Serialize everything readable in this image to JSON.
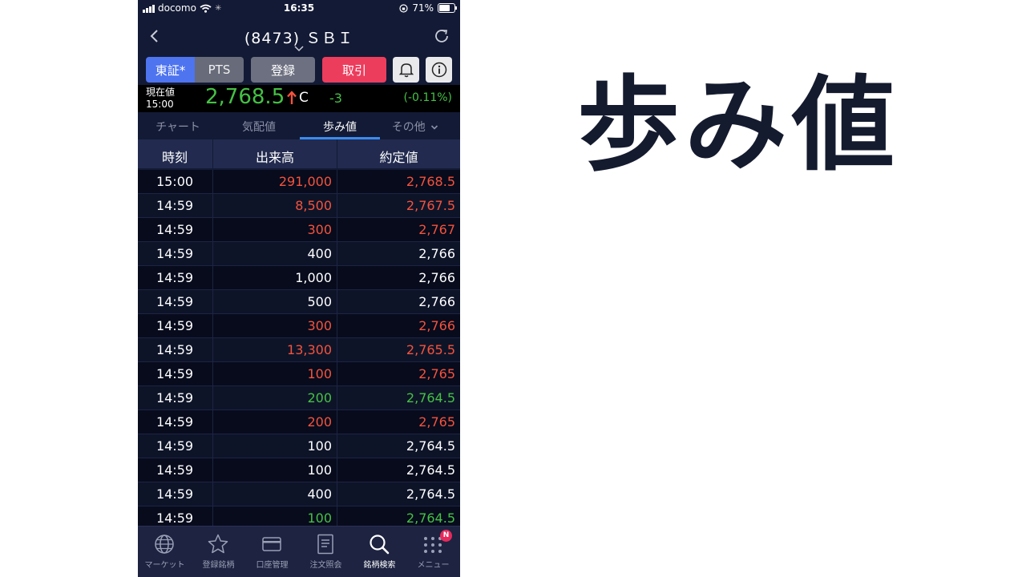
{
  "status_bar": {
    "carrier": "docomo",
    "time": "16:35",
    "battery": "71%",
    "battery_level": 0.71
  },
  "header": {
    "title": "(8473) ＳＢＩ"
  },
  "buttons": {
    "tosho": "東証*",
    "pts": "PTS",
    "register": "登録",
    "trade": "取引"
  },
  "price": {
    "label_line1": "現在値",
    "label_line2": "15:00",
    "value": "2,768.5",
    "flag": "C",
    "change": "-3",
    "change_pct": "(-0.11%)"
  },
  "tabs": [
    {
      "label": "チャート"
    },
    {
      "label": "気配値"
    },
    {
      "label": "歩み値",
      "active": true
    },
    {
      "label": "その他"
    }
  ],
  "table": {
    "headers": {
      "time": "時刻",
      "volume": "出来高",
      "price": "約定値"
    },
    "rows": [
      {
        "time": "15:00",
        "volume": "291,000",
        "price": "2,768.5",
        "color": "red"
      },
      {
        "time": "14:59",
        "volume": "8,500",
        "price": "2,767.5",
        "color": "red"
      },
      {
        "time": "14:59",
        "volume": "300",
        "price": "2,767",
        "color": "red"
      },
      {
        "time": "14:59",
        "volume": "400",
        "price": "2,766",
        "color": "white"
      },
      {
        "time": "14:59",
        "volume": "1,000",
        "price": "2,766",
        "color": "white"
      },
      {
        "time": "14:59",
        "volume": "500",
        "price": "2,766",
        "color": "white"
      },
      {
        "time": "14:59",
        "volume": "300",
        "price": "2,766",
        "color": "red"
      },
      {
        "time": "14:59",
        "volume": "13,300",
        "price": "2,765.5",
        "color": "red"
      },
      {
        "time": "14:59",
        "volume": "100",
        "price": "2,765",
        "color": "red"
      },
      {
        "time": "14:59",
        "volume": "200",
        "price": "2,764.5",
        "color": "green"
      },
      {
        "time": "14:59",
        "volume": "200",
        "price": "2,765",
        "color": "red"
      },
      {
        "time": "14:59",
        "volume": "100",
        "price": "2,764.5",
        "color": "white"
      },
      {
        "time": "14:59",
        "volume": "100",
        "price": "2,764.5",
        "color": "white"
      },
      {
        "time": "14:59",
        "volume": "400",
        "price": "2,764.5",
        "color": "white"
      },
      {
        "time": "14:59",
        "volume": "100",
        "price": "2,764.5",
        "color": "green"
      }
    ]
  },
  "tab_bar": [
    {
      "label": "マーケット",
      "icon": "globe-icon"
    },
    {
      "label": "登録銘柄",
      "icon": "star-icon"
    },
    {
      "label": "口座管理",
      "icon": "card-icon"
    },
    {
      "label": "注文照会",
      "icon": "document-icon"
    },
    {
      "label": "銘柄検索",
      "icon": "search-icon",
      "active": true
    },
    {
      "label": "メニュー",
      "icon": "grid-menu-icon",
      "badge": "N"
    }
  ],
  "heading": "歩み値",
  "colors": {
    "red": "#f4533d",
    "green": "#45c145",
    "white": "#ffffff",
    "accent_blue": "#4e74f0",
    "trade_red": "#ec3d5d"
  }
}
